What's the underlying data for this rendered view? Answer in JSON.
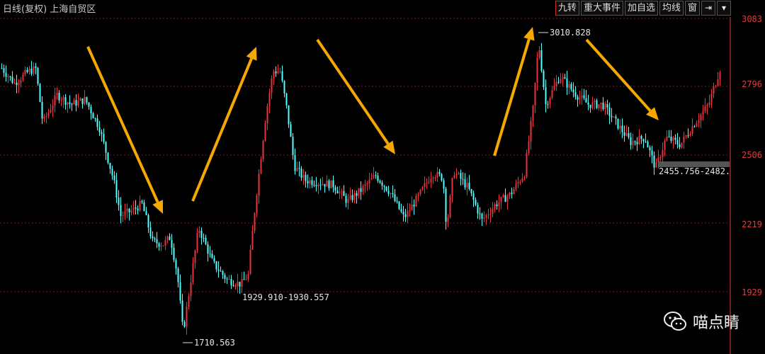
{
  "header": {
    "title": "日线(复权) 上海自贸区",
    "buttons": [
      "九转",
      "重大事件",
      "加自选",
      "均线",
      "窗"
    ],
    "pin_icon": "pin-icon",
    "menu_icon": "dropdown-caret-icon"
  },
  "watermark": {
    "icon": "wechat-icon",
    "text": "喵点睛"
  },
  "colors": {
    "background": "#000000",
    "up": "#e8343c",
    "down": "#54ffff",
    "axis": "#e03c3c",
    "grid": "#7a1a1a",
    "arrow": "#f5a800"
  },
  "chart_data": {
    "type": "candlestick",
    "y_axis_ticks": [
      "3083",
      "2796",
      "2506",
      "2219",
      "1929"
    ],
    "ylim": [
      1700,
      3083
    ],
    "grid": "horizontal dotted",
    "annotations": [
      {
        "text": "1710.563",
        "label": "low"
      },
      {
        "text": "1929.910-1930.557",
        "label": "range"
      },
      {
        "text": "3010.828",
        "label": "high"
      },
      {
        "text": "2455.756-2482.",
        "label": "gap"
      }
    ],
    "trend_arrows": [
      "down",
      "up",
      "down",
      "up",
      "down"
    ],
    "price_path": [
      [
        0,
        2880
      ],
      [
        20,
        2810
      ],
      [
        40,
        2860
      ],
      [
        50,
        2870
      ],
      [
        60,
        2640
      ],
      [
        80,
        2760
      ],
      [
        100,
        2720
      ],
      [
        120,
        2740
      ],
      [
        140,
        2620
      ],
      [
        160,
        2400
      ],
      [
        170,
        2250
      ],
      [
        185,
        2270
      ],
      [
        200,
        2300
      ],
      [
        215,
        2140
      ],
      [
        230,
        2130
      ],
      [
        240,
        2160
      ],
      [
        250,
        2000
      ],
      [
        258,
        1755
      ],
      [
        268,
        1960
      ],
      [
        280,
        2200
      ],
      [
        300,
        2050
      ],
      [
        320,
        1980
      ],
      [
        340,
        1960
      ],
      [
        350,
        2000
      ],
      [
        360,
        2300
      ],
      [
        375,
        2680
      ],
      [
        385,
        2860
      ],
      [
        395,
        2860
      ],
      [
        405,
        2690
      ],
      [
        415,
        2460
      ],
      [
        430,
        2400
      ],
      [
        450,
        2390
      ],
      [
        470,
        2380
      ],
      [
        490,
        2310
      ],
      [
        510,
        2360
      ],
      [
        530,
        2420
      ],
      [
        550,
        2350
      ],
      [
        570,
        2240
      ],
      [
        590,
        2330
      ],
      [
        610,
        2430
      ],
      [
        625,
        2410
      ],
      [
        630,
        2200
      ],
      [
        640,
        2440
      ],
      [
        660,
        2370
      ],
      [
        680,
        2230
      ],
      [
        700,
        2300
      ],
      [
        720,
        2340
      ],
      [
        740,
        2430
      ],
      [
        752,
        2700
      ],
      [
        760,
        2980
      ],
      [
        770,
        2720
      ],
      [
        790,
        2840
      ],
      [
        810,
        2770
      ],
      [
        830,
        2720
      ],
      [
        850,
        2720
      ],
      [
        870,
        2640
      ],
      [
        890,
        2560
      ],
      [
        910,
        2580
      ],
      [
        925,
        2450
      ],
      [
        940,
        2580
      ],
      [
        960,
        2550
      ],
      [
        980,
        2640
      ],
      [
        1000,
        2720
      ],
      [
        1016,
        2870
      ]
    ]
  }
}
